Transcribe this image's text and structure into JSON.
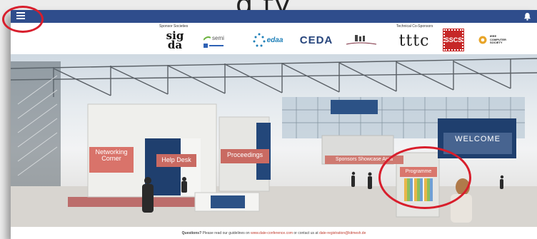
{
  "page_heading_fragment": "g ty",
  "topbar": {
    "menu_icon": "hamburger-menu-icon",
    "notification_icon": "bell-icon",
    "bar_color": "#2f4d8c"
  },
  "sponsors": {
    "sponsor_label": "Sponsor Societies",
    "cosponsor_label": "Technical Co-Sponsors",
    "logos": {
      "sigda_top": "sig",
      "sigda_bottom": "da",
      "semi": "semi",
      "edaa": "edaa",
      "ceda": "CEDA",
      "tttc": "tttc",
      "ssc": "SSCS",
      "computer_society_l1": "IEEE",
      "computer_society_l2": "COMPUTER",
      "computer_society_l3": "SOCIETY"
    }
  },
  "booths": {
    "networking": "Networking Corner",
    "help_desk": "Help Desk",
    "proceedings": "Proceedings",
    "sponsors": "Sponsors Showcase Area",
    "programme": "Programme",
    "welcome": "WELCOME"
  },
  "footer": {
    "questions_label": "Questions?",
    "text_1": "Please read our guidelines on",
    "link_1": "www.date-conference.com",
    "text_2": "or contact us at",
    "link_2": "date-registration@kitmesh.de"
  },
  "highlight_color": "#d81e2c"
}
